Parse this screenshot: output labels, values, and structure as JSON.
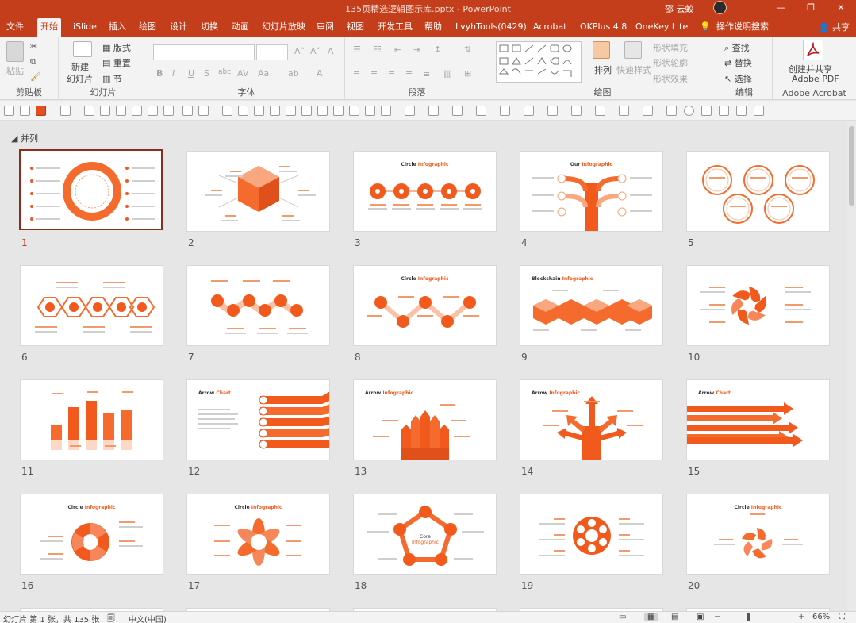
{
  "window": {
    "title": "135页精选逻辑图示库.pptx - PowerPoint",
    "user": "邵 云蛟",
    "minimize": "—",
    "restore": "❐",
    "close": "✕"
  },
  "tabs": [
    "文件",
    "开始",
    "iSlide",
    "插入",
    "绘图",
    "设计",
    "切换",
    "动画",
    "幻灯片放映",
    "审阅",
    "视图",
    "开发工具",
    "帮助",
    "LvyhTools(0429)",
    "Acrobat",
    "OKPlus 4.8",
    "OneKey Lite",
    "操作说明搜索"
  ],
  "active_tab": "开始",
  "share_label": "共享",
  "ribbon": {
    "clipboard": {
      "paste": "粘贴",
      "label": "剪贴板"
    },
    "slides": {
      "new_slide": "新建",
      "new_slide_sub": "幻灯片",
      "layout": "版式",
      "reset": "重置",
      "section": "节",
      "label": "幻灯片"
    },
    "font": {
      "label": "字体"
    },
    "paragraph": {
      "label": "段落"
    },
    "drawing": {
      "arrange": "排列",
      "quick_styles": "快速样式",
      "shape_fill": "形状填充",
      "shape_outline": "形状轮廓",
      "shape_effects": "形状效果",
      "label": "绘图"
    },
    "editing": {
      "find": "查找",
      "replace": "替换",
      "select": "选择",
      "label": "编辑"
    },
    "acrobat": {
      "create_share": "创建并共享",
      "adobe_pdf": "Adobe PDF",
      "label": "Adobe Acrobat"
    }
  },
  "section_name": "并列",
  "slides": [
    {
      "num": "1",
      "title": ""
    },
    {
      "num": "2",
      "title": ""
    },
    {
      "num": "3",
      "title": "Circle",
      "title_accent": "Infographic"
    },
    {
      "num": "4",
      "title": "Our",
      "title_accent": "Infographic"
    },
    {
      "num": "5",
      "title": ""
    },
    {
      "num": "6",
      "title": ""
    },
    {
      "num": "7",
      "title": ""
    },
    {
      "num": "8",
      "title": "Circle",
      "title_accent": "Infographic"
    },
    {
      "num": "9",
      "title": "Blockchain",
      "title_accent": "Infographic"
    },
    {
      "num": "10",
      "title": ""
    },
    {
      "num": "11",
      "title": ""
    },
    {
      "num": "12",
      "title": "Arrow",
      "title_accent": "Chart"
    },
    {
      "num": "13",
      "title": "Arrow",
      "title_accent": "Infographic"
    },
    {
      "num": "14",
      "title": "Arrow",
      "title_accent": "Infographic"
    },
    {
      "num": "15",
      "title": "Arrow",
      "title_accent": "Chart"
    },
    {
      "num": "16",
      "title": "Circle",
      "title_accent": "Infographic"
    },
    {
      "num": "17",
      "title": "Circle",
      "title_accent": "Infographic"
    },
    {
      "num": "18",
      "title": "",
      "center": "Core",
      "center_accent": "Infographic"
    },
    {
      "num": "19",
      "title": ""
    },
    {
      "num": "20",
      "title": "Circle",
      "title_accent": "Infographic"
    }
  ],
  "status": {
    "slide_info": "幻灯片 第 1 张，共 135 张",
    "language": "中文(中国)",
    "zoom": "66%"
  },
  "colors": {
    "accent": "#c43e1c",
    "orange": "#f25a1d",
    "light_orange": "#f7a07a"
  }
}
